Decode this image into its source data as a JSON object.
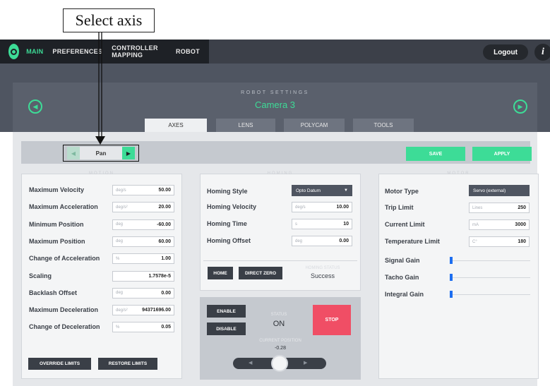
{
  "callout": {
    "text": "Select axis"
  },
  "nav": {
    "items": [
      "MAIN",
      "PREFERENCES",
      "CONTROLLER MAPPING",
      "ROBOT"
    ],
    "logout": "Logout",
    "info": "i"
  },
  "header": {
    "label": "ROBOT SETTINGS",
    "camera": "Camera 3"
  },
  "tabs": [
    "AXES",
    "LENS",
    "POLYCAM",
    "TOOLS"
  ],
  "axis_selector": {
    "value": "Pan"
  },
  "toolbar": {
    "save": "SAVE",
    "apply": "APPLY"
  },
  "motion": {
    "title": "MOTION",
    "fields": [
      {
        "label": "Maximum Velocity",
        "unit": "deg/s",
        "value": "50.00"
      },
      {
        "label": "Maximum Acceleration",
        "unit": "deg/s²",
        "value": "20.00"
      },
      {
        "label": "Minimum Position",
        "unit": "deg",
        "value": "-60.00"
      },
      {
        "label": "Maximum Position",
        "unit": "deg",
        "value": "60.00"
      },
      {
        "label": "Change of Acceleration",
        "unit": "%",
        "value": "1.00"
      },
      {
        "label": "Scaling",
        "unit": "",
        "value": "1.7578e-5"
      },
      {
        "label": "Backlash Offset",
        "unit": "deg",
        "value": "0.00"
      },
      {
        "label": "Maximum Deceleration",
        "unit": "deg/s²",
        "value": "94371696.00"
      },
      {
        "label": "Change of Deceleration",
        "unit": "%",
        "value": "0.05"
      }
    ],
    "override": "OVERRIDE LIMITS",
    "restore": "RESTORE LIMITS"
  },
  "homing": {
    "title": "HOMING",
    "style_label": "Homing Style",
    "style_value": "Opto Datum",
    "fields": [
      {
        "label": "Homing Velocity",
        "unit": "deg/s",
        "value": "10.00"
      },
      {
        "label": "Homing Time",
        "unit": "s",
        "value": "10"
      },
      {
        "label": "Homing Offset",
        "unit": "deg",
        "value": "0.00"
      }
    ],
    "home": "HOME",
    "direct_zero": "DIRECT ZERO",
    "status_label": "HOMING STATUS",
    "status_value": "Success"
  },
  "control": {
    "enable": "ENABLE",
    "disable": "DISABLE",
    "status_label": "STATUS",
    "status_value": "ON",
    "stop": "STOP",
    "position_label": "CURRENT POSITION",
    "position_value": "-0.28"
  },
  "motor": {
    "title": "MOTOR",
    "type_label": "Motor Type",
    "type_value": "Servo (external)",
    "fields": [
      {
        "label": "Trip Limit",
        "unit": "Lines",
        "value": "250"
      },
      {
        "label": "Current Limit",
        "unit": "mA",
        "value": "3000"
      },
      {
        "label": "Temperature Limit",
        "unit": "C°",
        "value": "180"
      }
    ],
    "gains": [
      {
        "label": "Signal Gain",
        "level": 0.0
      },
      {
        "label": "Tacho Gain",
        "level": 0.0
      },
      {
        "label": "Integral Gain",
        "level": 0.0
      }
    ]
  },
  "colors": {
    "accent": "#3ddc97",
    "stop": "#f04e65",
    "gain": "#1d6ef0"
  }
}
